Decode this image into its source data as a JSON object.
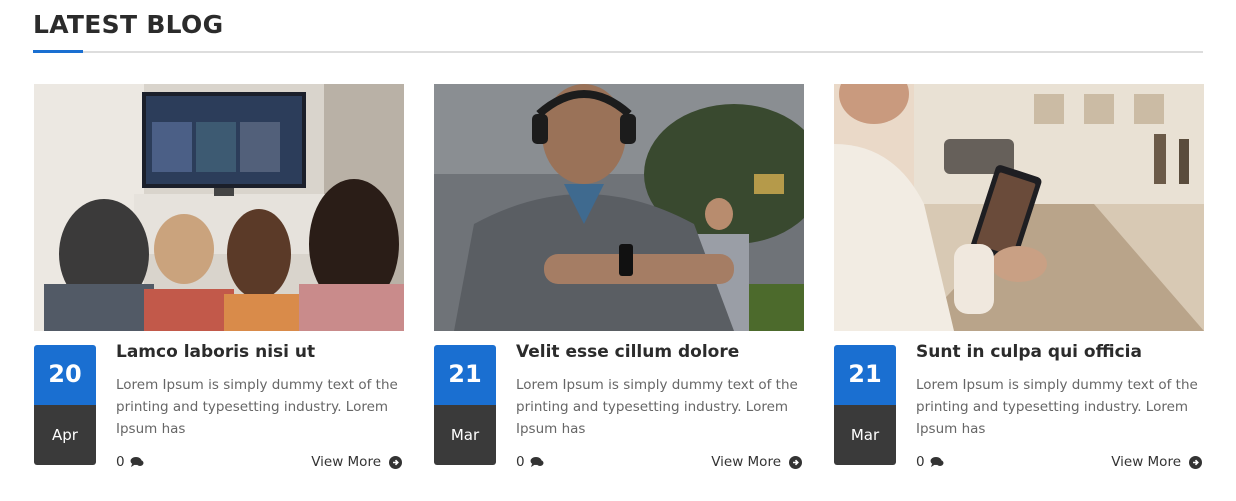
{
  "section": {
    "title": "LATEST BLOG"
  },
  "colors": {
    "accent": "#1a6fd1",
    "month_bg": "#3a3a3a"
  },
  "posts": [
    {
      "image": "family-watching-tv-photo",
      "day": "20",
      "month": "Apr",
      "title": "Lamco laboris nisi ut",
      "excerpt": "Lorem Ipsum is simply dummy text of the printing and typesetting industry. Lorem Ipsum has",
      "comments": "0",
      "view_more": "View More"
    },
    {
      "image": "man-with-smartwatch-photo",
      "day": "21",
      "month": "Mar",
      "title": "Velit esse cillum dolore",
      "excerpt": "Lorem Ipsum is simply dummy text of the printing and typesetting industry. Lorem Ipsum has",
      "comments": "0",
      "view_more": "View More"
    },
    {
      "image": "woman-with-tablet-photo",
      "day": "21",
      "month": "Mar",
      "title": "Sunt in culpa qui officia",
      "excerpt": "Lorem Ipsum is simply dummy text of the printing and typesetting industry. Lorem Ipsum has",
      "comments": "0",
      "view_more": "View More"
    }
  ]
}
